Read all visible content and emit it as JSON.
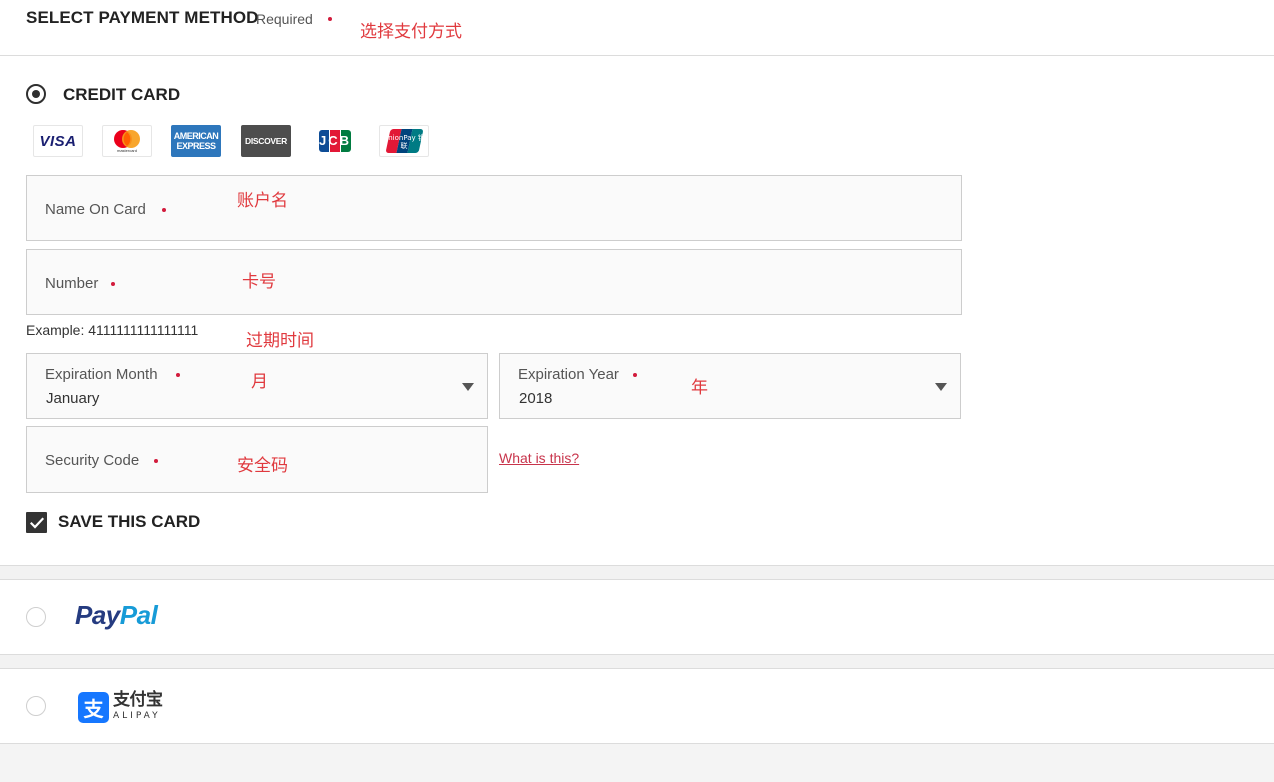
{
  "header": {
    "title": "SELECT PAYMENT METHOD",
    "required": "Required",
    "annotation": "选择支付方式"
  },
  "credit_card": {
    "label": "CREDIT CARD",
    "logos": [
      {
        "name": "visa",
        "text": "VISA"
      },
      {
        "name": "mastercard",
        "text": "mastercard"
      },
      {
        "name": "american-express",
        "text": "AMERICAN EXPRESS"
      },
      {
        "name": "discover",
        "text": "DISCOVER"
      },
      {
        "name": "jcb",
        "text": "JCB"
      },
      {
        "name": "unionpay",
        "text": "UnionPay 银联"
      }
    ],
    "name_on_card": {
      "label": "Name On Card",
      "annotation": "账户名"
    },
    "number": {
      "label": "Number",
      "annotation": "卡号"
    },
    "example": "Example: 4111111111111111",
    "expiration_annotation": "过期时间",
    "expiration_month": {
      "label": "Expiration Month",
      "value": "January",
      "annotation": "月"
    },
    "expiration_year": {
      "label": "Expiration Year",
      "value": "2018",
      "annotation": "年"
    },
    "security_code": {
      "label": "Security Code",
      "annotation": "安全码"
    },
    "what_is_this": "What is this?",
    "save_card": {
      "label": "SAVE THIS CARD",
      "checked": true
    }
  },
  "paypal": {
    "logo_text_1": "Pay",
    "logo_text_2": "Pal"
  },
  "alipay": {
    "logo_cn": "支付宝",
    "logo_en": "ALIPAY"
  },
  "colors": {
    "required_dot": "#d21b3c",
    "annotation": "#e0393e",
    "link": "#c8344b",
    "paypal_dark": "#253b80",
    "paypal_light": "#179bd7",
    "alipay_blue": "#1677ff"
  }
}
